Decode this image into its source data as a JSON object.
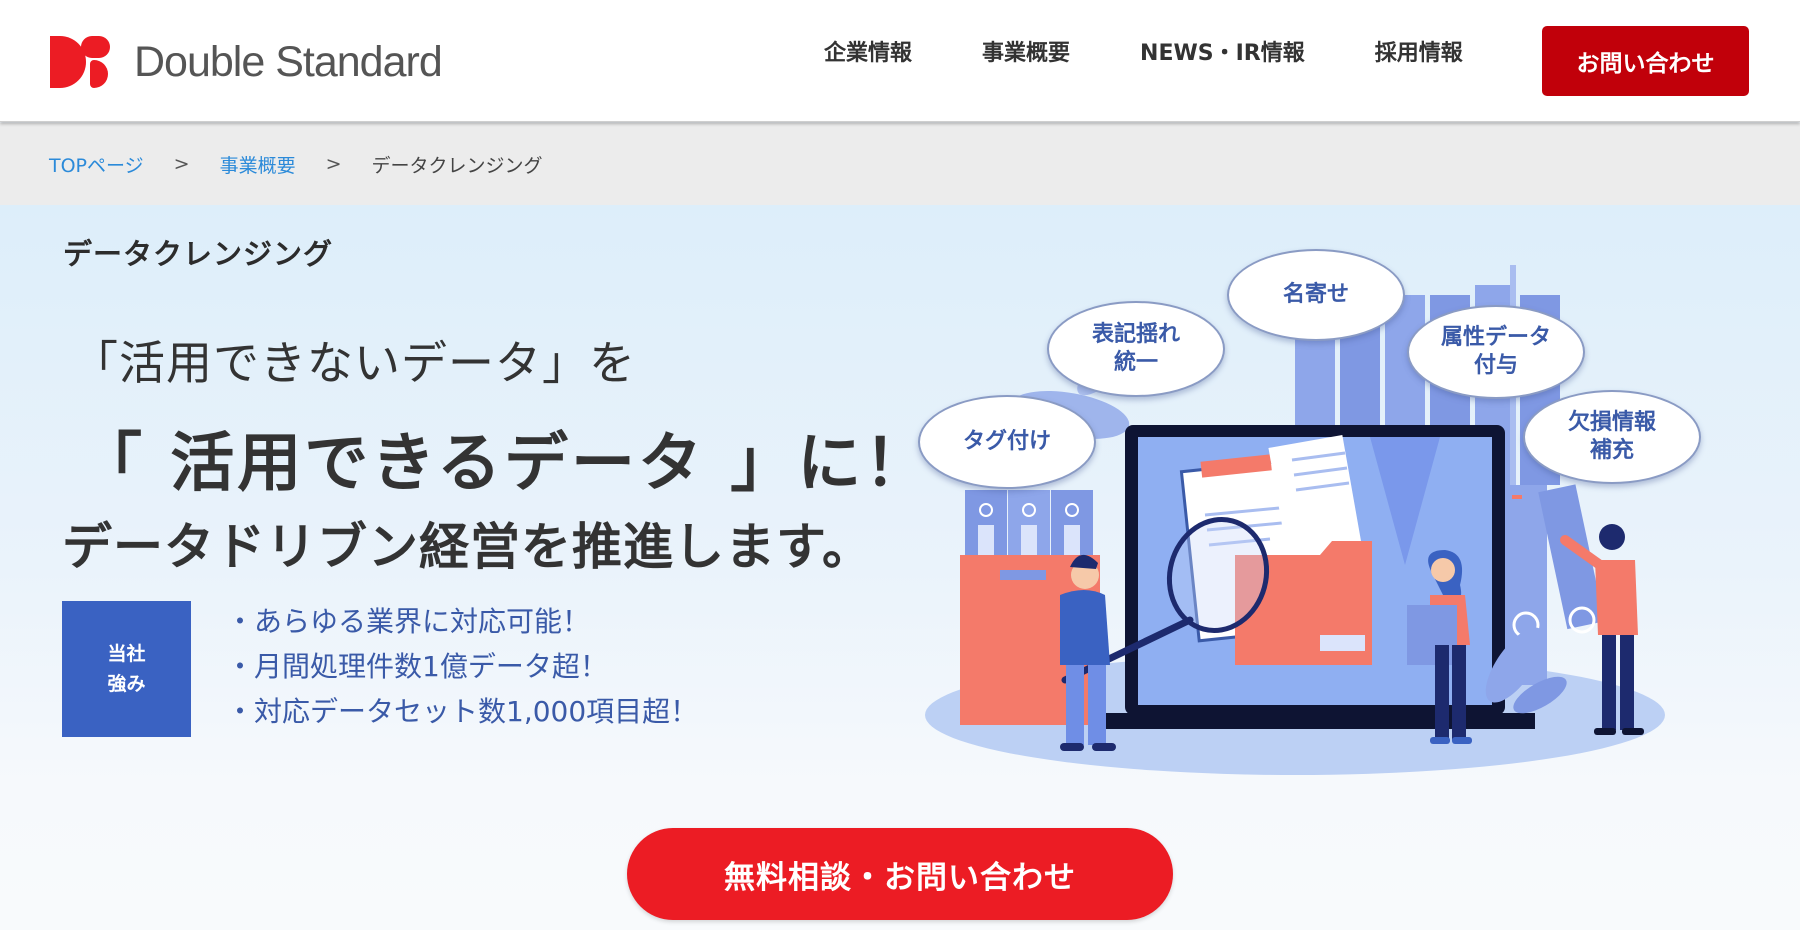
{
  "header": {
    "logo_text": "Double Standard",
    "brand_color": "#ec1c24",
    "nav": [
      {
        "label": "企業情報"
      },
      {
        "label": "事業概要"
      },
      {
        "label": "NEWS・IR情報"
      },
      {
        "label": "採用情報"
      }
    ],
    "contact_button": "お問い合わせ",
    "contact_button_color": "#c1000a"
  },
  "breadcrumb": {
    "items": [
      {
        "label": "TOPページ"
      },
      {
        "label": "事業概要"
      }
    ],
    "separator": ">",
    "current": "データクレンジング"
  },
  "hero": {
    "page_title": "データクレンジング",
    "headline_1": "「活用できないデータ」を",
    "headline_2": "「 活用できるデータ 」に！",
    "headline_3": "データドリブン経営を推進します。",
    "strength_badge": {
      "line1": "当社",
      "line2": "強み",
      "color": "#3a62c2"
    },
    "strengths": [
      "・あらゆる業界に対応可能！",
      "・月間処理件数1億データ超！",
      "・対応データセット数1,000項目超！"
    ],
    "illustration": {
      "bubbles": [
        {
          "line1": "タグ付け",
          "line2": ""
        },
        {
          "line1": "表記揺れ",
          "line2": "統一"
        },
        {
          "line1": "名寄せ",
          "line2": ""
        },
        {
          "line1": "属性データ",
          "line2": "付与"
        },
        {
          "line1": "欠損情報",
          "line2": "補充"
        }
      ]
    }
  },
  "cta": {
    "label": "無料相談・お問い合わせ",
    "color": "#ec1c24"
  }
}
